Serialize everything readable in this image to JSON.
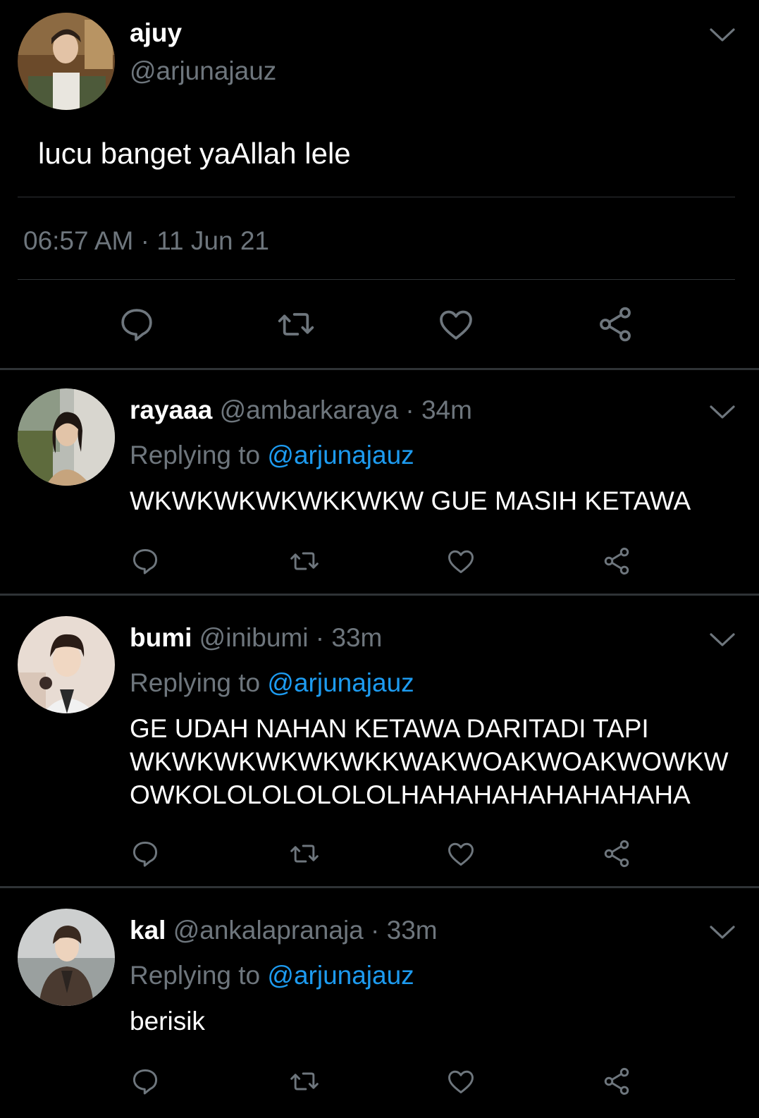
{
  "colors": {
    "background": "#000000",
    "text": "#ffffff",
    "muted": "#6e767d",
    "link": "#1d9bf0",
    "divider": "#2f3336"
  },
  "main_tweet": {
    "display_name": "ajuy",
    "handle": "@arjunajauz",
    "text": "lucu banget yaAllah lele",
    "timestamp": "06:57 AM · 11 Jun 21",
    "icons": [
      "reply-icon",
      "retweet-icon",
      "like-icon",
      "share-icon"
    ]
  },
  "replies": [
    {
      "display_name": "rayaaa",
      "handle": "@ambarkaraya",
      "separator": "·",
      "time": "34m",
      "replying_prefix": "Replying to",
      "replying_handle": "@arjunajauz",
      "text": "WKWKWKWKWKKWKW GUE MASIH KETAWA"
    },
    {
      "display_name": "bumi",
      "handle": "@inibumi",
      "separator": "·",
      "time": "33m",
      "replying_prefix": "Replying to",
      "replying_handle": "@arjunajauz",
      "text_lines": [
        "GE UDAH NAHAN KETAWA DARITADI TAPI",
        "WKWKWKWKWKWKKWAKWOAKWOAKWOWKW",
        "OWKOLOLOLOLOLOLHAHAHAHAHAHAHAHA"
      ]
    },
    {
      "display_name": "kal",
      "handle": "@ankalapranaja",
      "separator": "·",
      "time": "33m",
      "replying_prefix": "Replying to",
      "replying_handle": "@arjunajauz",
      "text": "berisik"
    }
  ]
}
